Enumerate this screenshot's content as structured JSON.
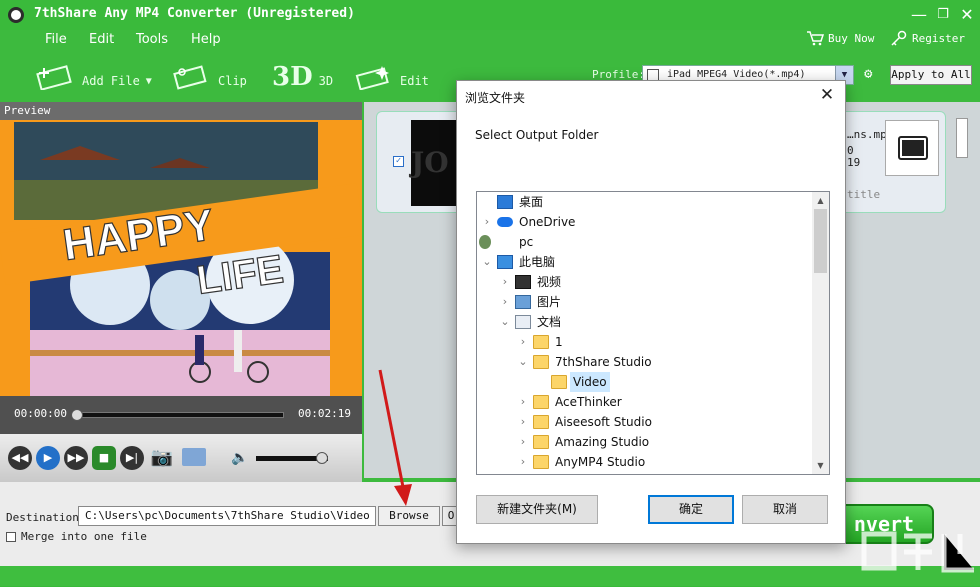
{
  "window": {
    "title": "7thShare Any MP4 Converter (Unregistered)",
    "minimize": "—",
    "restore": "❐",
    "close": "✕"
  },
  "menu": [
    "File",
    "Edit",
    "Tools",
    "Help"
  ],
  "header_links": {
    "buy_now": "Buy Now",
    "register": "Register"
  },
  "toolbar": {
    "add_file": "Add File",
    "clip": "Clip",
    "three_d_icon": "3D",
    "three_d": "3D",
    "edit": "Edit"
  },
  "profile": {
    "label": "Profile:",
    "value": "iPad MPEG4 Video(*.mp4)",
    "apply_to_all": "Apply to All"
  },
  "preview": {
    "label": "Preview",
    "video_text_1": "HAPPY",
    "video_text_2": "LIFE",
    "current_time": "00:00:00",
    "total_time": "00:02:19",
    "seek_fraction": 0.0,
    "volume_fraction": 0.9
  },
  "file_item": {
    "filename_fragment": "…ns.mp",
    "line2": "0",
    "line3": "19",
    "subtitle_fragment": "title",
    "thumb_text": "JO"
  },
  "bottom": {
    "destination_label": "Destination:",
    "destination_value": "C:\\Users\\pc\\Documents\\7thShare Studio\\Video",
    "browse": "Browse",
    "open_fragment": "O",
    "merge_label": "Merge into one file",
    "convert_fragment": "nvert"
  },
  "dialog": {
    "title": "浏览文件夹",
    "close": "✕",
    "subtitle": "Select Output Folder",
    "tree": [
      {
        "label": "桌面",
        "icon": "desktop-icon",
        "level": 0,
        "chevron": ""
      },
      {
        "label": "OneDrive",
        "icon": "cloud-icon",
        "level": 0,
        "chevron": "›"
      },
      {
        "label": "pc",
        "icon": "user-icon",
        "level": 0,
        "chevron": "›"
      },
      {
        "label": "此电脑",
        "icon": "computer-icon",
        "level": 0,
        "chevron": "⌄"
      },
      {
        "label": "视频",
        "icon": "video-folder-icon",
        "level": 1,
        "chevron": "›"
      },
      {
        "label": "图片",
        "icon": "pictures-folder-icon",
        "level": 1,
        "chevron": "›"
      },
      {
        "label": "文档",
        "icon": "documents-folder-icon",
        "level": 1,
        "chevron": "⌄"
      },
      {
        "label": "1",
        "icon": "folder-icon",
        "level": 2,
        "chevron": "›"
      },
      {
        "label": "7thShare Studio",
        "icon": "folder-icon",
        "level": 2,
        "chevron": "⌄"
      },
      {
        "label": "Video",
        "icon": "folder-icon",
        "level": 3,
        "chevron": "",
        "selected": true
      },
      {
        "label": "AceThinker",
        "icon": "folder-icon",
        "level": 2,
        "chevron": "›"
      },
      {
        "label": "Aiseesoft Studio",
        "icon": "folder-icon",
        "level": 2,
        "chevron": "›"
      },
      {
        "label": "Amazing Studio",
        "icon": "folder-icon",
        "level": 2,
        "chevron": "›"
      },
      {
        "label": "AnyMP4 Studio",
        "icon": "folder-icon",
        "level": 2,
        "chevron": "›"
      }
    ],
    "new_folder": "新建文件夹(M)",
    "ok": "确定",
    "cancel": "取消"
  },
  "colors": {
    "brand_green": "#3dba3e",
    "dialog_accent": "#0078d7",
    "selection": "#cce8ff",
    "arrow_red": "#d11a1a"
  }
}
